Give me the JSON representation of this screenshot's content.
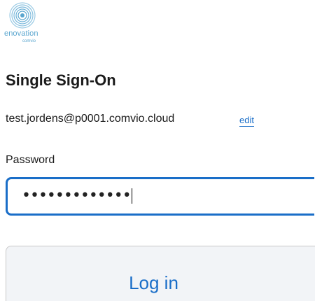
{
  "brand": {
    "name": "enovation",
    "subname": "comvio",
    "icon": "swirl-logo-icon",
    "color": "#5aa6cf"
  },
  "sso": {
    "title": "Single Sign-On",
    "account_email": "test.jordens@p0001.comvio.cloud",
    "edit_label": "edit"
  },
  "password": {
    "label": "Password",
    "masked_value": "•••••••••••••"
  },
  "actions": {
    "login_label": "Log in"
  },
  "colors": {
    "accent": "#1a6ec8",
    "button_bg": "#f2f4f7",
    "text": "#1a1a1a"
  }
}
